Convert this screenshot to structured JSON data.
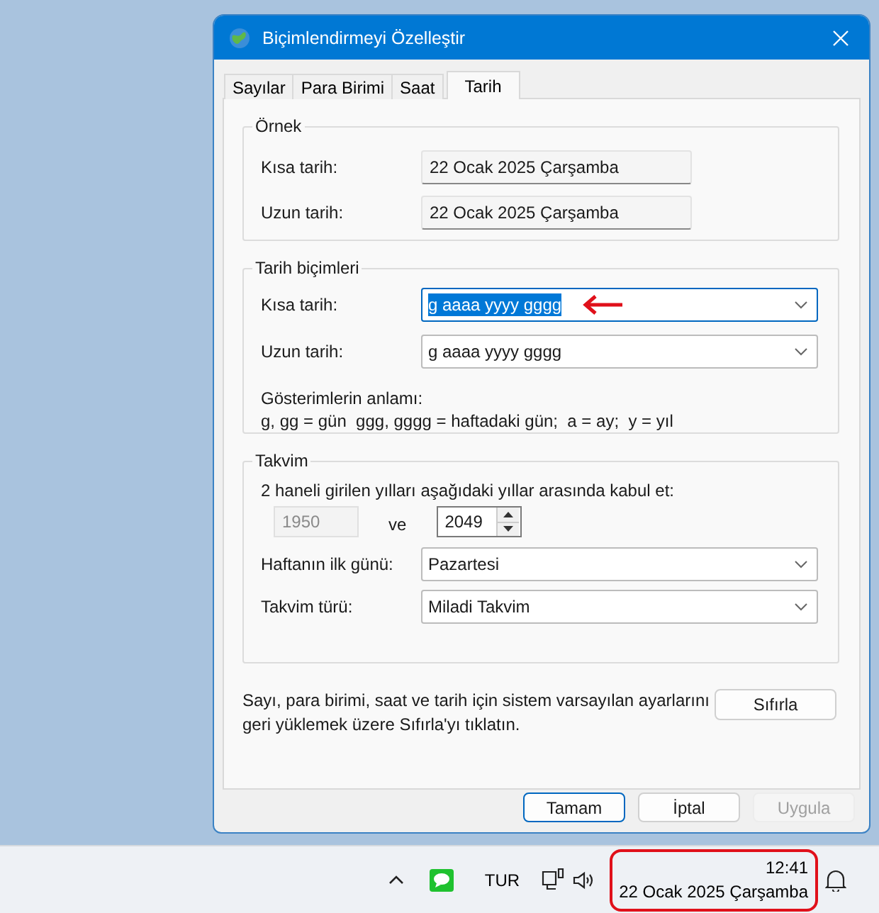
{
  "window": {
    "title": "Biçimlendirmeyi Özelleştir"
  },
  "tabs": [
    {
      "label": "Sayılar",
      "selected": false
    },
    {
      "label": "Para Birimi",
      "selected": false
    },
    {
      "label": "Saat",
      "selected": false
    },
    {
      "label": "Tarih",
      "selected": true
    }
  ],
  "sample": {
    "title": "Örnek",
    "rows": [
      {
        "label": "Kısa tarih:",
        "value": "22 Ocak 2025 Çarşamba"
      },
      {
        "label": "Uzun tarih:",
        "value": "22 Ocak 2025 Çarşamba"
      }
    ]
  },
  "formats": {
    "title": "Tarih biçimleri",
    "rows": [
      {
        "label": "Kısa tarih:",
        "value": "g aaaa yyyy gggg",
        "selected": true,
        "arrow": true
      },
      {
        "label": "Uzun tarih:",
        "value": "g aaaa yyyy gggg",
        "selected": false,
        "arrow": false
      }
    ],
    "legend_title": "Gösterimlerin anlamı:",
    "legend": "g, gg = gün  ggg, gggg = haftadaki gün;  a = ay;  y = yıl"
  },
  "calendar": {
    "title": "Takvim",
    "two_digit_label": "2 haneli girilen yılları aşağıdaki yıllar arasında kabul et:",
    "year_from": {
      "value": "1950",
      "disabled": true
    },
    "and_label": "ve",
    "year_to": {
      "value": "2049",
      "disabled": false
    },
    "rows": [
      {
        "label": "Haftanın ilk günü:",
        "value": "Pazartesi"
      },
      {
        "label": "Takvim türü:",
        "value": "Miladi Takvim"
      }
    ]
  },
  "reset": {
    "lines": [
      "Sayı, para birimi, saat ve tarih için sistem varsayılan ayarlarını",
      "geri yüklemek üzere Sıfırla'yı tıklatın."
    ],
    "button": "Sıfırla"
  },
  "buttons": [
    {
      "label": "Tamam",
      "kind": "default",
      "disabled": false
    },
    {
      "label": "İptal",
      "kind": "normal",
      "disabled": false
    },
    {
      "label": "Uygula",
      "kind": "normal",
      "disabled": true
    }
  ],
  "taskbar": {
    "language": "TUR",
    "time": "12:41",
    "date": "22 Ocak 2025 Çarşamba",
    "highlighted": true
  }
}
